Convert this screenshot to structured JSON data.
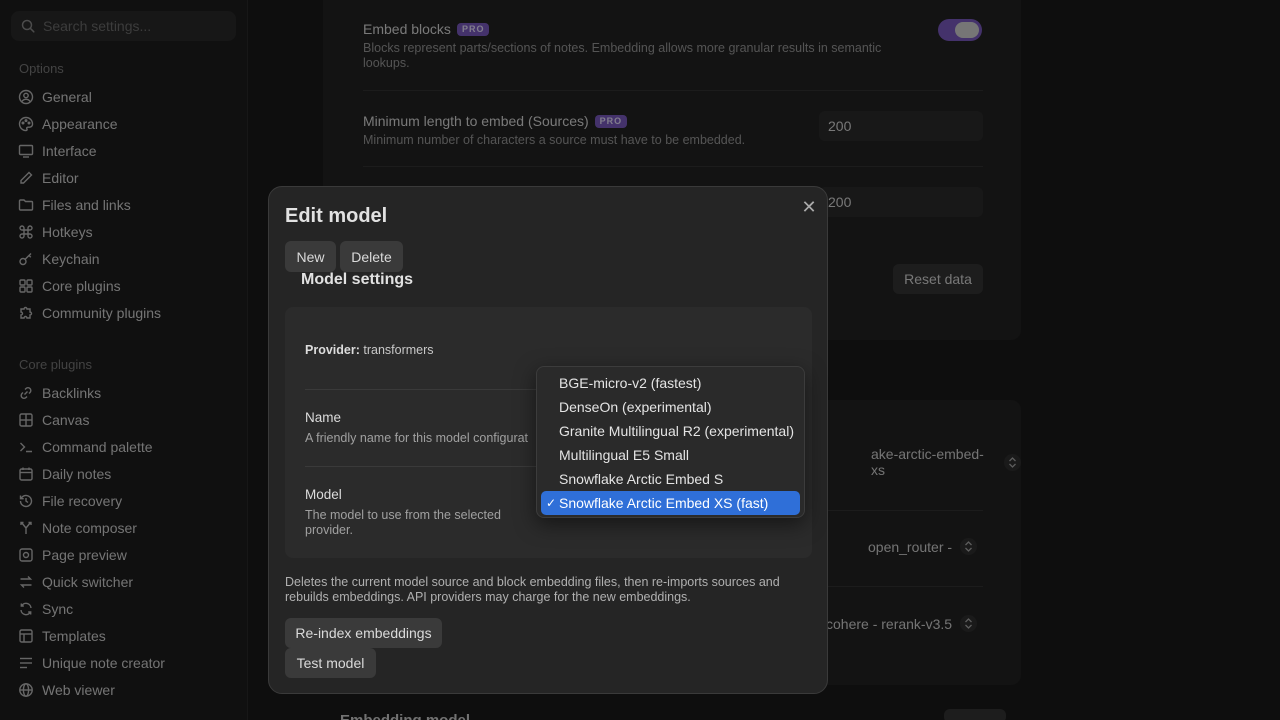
{
  "sidebar": {
    "search_placeholder": "Search settings...",
    "options_title": "Options",
    "options": [
      {
        "label": "General",
        "icon": "user-circle-icon"
      },
      {
        "label": "Appearance",
        "icon": "palette-icon"
      },
      {
        "label": "Interface",
        "icon": "monitor-icon"
      },
      {
        "label": "Editor",
        "icon": "pencil-icon"
      },
      {
        "label": "Files and links",
        "icon": "folder-icon"
      },
      {
        "label": "Hotkeys",
        "icon": "command-icon"
      },
      {
        "label": "Keychain",
        "icon": "key-icon"
      },
      {
        "label": "Core plugins",
        "icon": "plug-icon"
      },
      {
        "label": "Community plugins",
        "icon": "puzzle-icon"
      }
    ],
    "core_title": "Core plugins",
    "core": [
      {
        "label": "Backlinks",
        "icon": "link-icon"
      },
      {
        "label": "Canvas",
        "icon": "grid-icon"
      },
      {
        "label": "Command palette",
        "icon": "terminal-icon"
      },
      {
        "label": "Daily notes",
        "icon": "calendar-icon"
      },
      {
        "label": "File recovery",
        "icon": "history-icon"
      },
      {
        "label": "Note composer",
        "icon": "merge-icon"
      },
      {
        "label": "Page preview",
        "icon": "preview-icon"
      },
      {
        "label": "Quick switcher",
        "icon": "switch-icon"
      },
      {
        "label": "Sync",
        "icon": "sync-icon"
      },
      {
        "label": "Templates",
        "icon": "template-icon"
      },
      {
        "label": "Unique note creator",
        "icon": "list-icon"
      },
      {
        "label": "Web viewer",
        "icon": "globe-icon"
      }
    ]
  },
  "background": {
    "embed_blocks": {
      "name": "Embed blocks",
      "badge": "PRO",
      "desc": "Blocks represent parts/sections of notes. Embedding allows more granular results in semantic lookups.",
      "enabled": true
    },
    "min_length_sources": {
      "name": "Minimum length to embed (Sources)",
      "badge": "PRO",
      "desc": "Minimum number of characters a source must have to be embedded.",
      "value": "200"
    },
    "min_length_blocks": {
      "value": "200"
    },
    "reset_label": "Reset data",
    "embed_model_value": "ake-arctic-embed-xs",
    "chat_model_value": "open_router -",
    "rerank_value": "cohere - rerank-v3.5",
    "bottom_heading": "Embedding model"
  },
  "modal": {
    "title": "Edit model",
    "new_label": "New",
    "delete_label": "Delete",
    "section_title": "Model settings",
    "provider_label": "Provider:",
    "provider_value": "transformers",
    "name_label": "Name",
    "name_desc": "A friendly name for this model configurat",
    "model_label": "Model",
    "model_desc": "The model to use from the selected provider.",
    "reindex_desc": "Deletes the current model source and block embedding files, then re-imports sources and rebuilds embeddings. API providers may charge for the new embeddings.",
    "reindex_label": "Re-index embeddings",
    "test_label": "Test model"
  },
  "dropdown": {
    "options": [
      "BGE-micro-v2 (fastest)",
      "DenseOn (experimental)",
      "Granite Multilingual R2 (experimental)",
      "Multilingual E5 Small",
      "Snowflake Arctic Embed S",
      "Snowflake Arctic Embed XS (fast)"
    ],
    "selected": "Snowflake Arctic Embed XS (fast)",
    "check": "✓"
  },
  "colors": {
    "accent": "#7c5cc4",
    "selection": "#2f6fd8"
  }
}
